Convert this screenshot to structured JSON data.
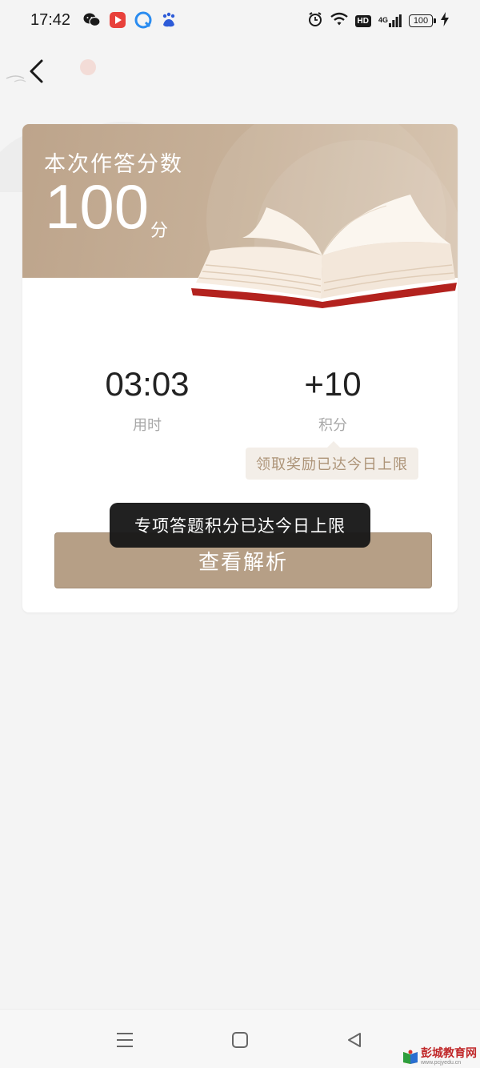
{
  "status_bar": {
    "time": "17:42",
    "left_icons": [
      "wechat-icon",
      "video-app-icon",
      "browser-app-icon",
      "baidu-icon"
    ],
    "right_icons": [
      "alarm-icon",
      "wifi-icon",
      "hd-badge",
      "signal-4g-icon",
      "battery-icon",
      "charging-icon"
    ],
    "hd_label": "HD",
    "network_label": "4G",
    "battery_level": "100"
  },
  "header": {
    "back_icon": "chevron-left-icon"
  },
  "result_card": {
    "score_label": "本次作答分数",
    "score_value": "100",
    "score_unit": "分",
    "banner_illustration": "open-book-illustration",
    "time_value": "03:03",
    "time_label": "用时",
    "points_value": "+10",
    "points_label": "积分",
    "reward_tip": "领取奖励已达今日上限",
    "analysis_button": "查看解析"
  },
  "toast": {
    "message": "专项答题积分已达今日上限"
  },
  "nav_bar": {
    "items": [
      "menu-icon",
      "home-icon",
      "back-icon"
    ]
  },
  "watermark": {
    "title": "彭城教育网",
    "url": "www.pcjyedu.cn"
  },
  "colors": {
    "banner": "#c4ad94",
    "button": "#b69f86",
    "tip_text": "#ad9478",
    "toast_bg": "#181818",
    "page_bg": "#f4f4f4"
  }
}
